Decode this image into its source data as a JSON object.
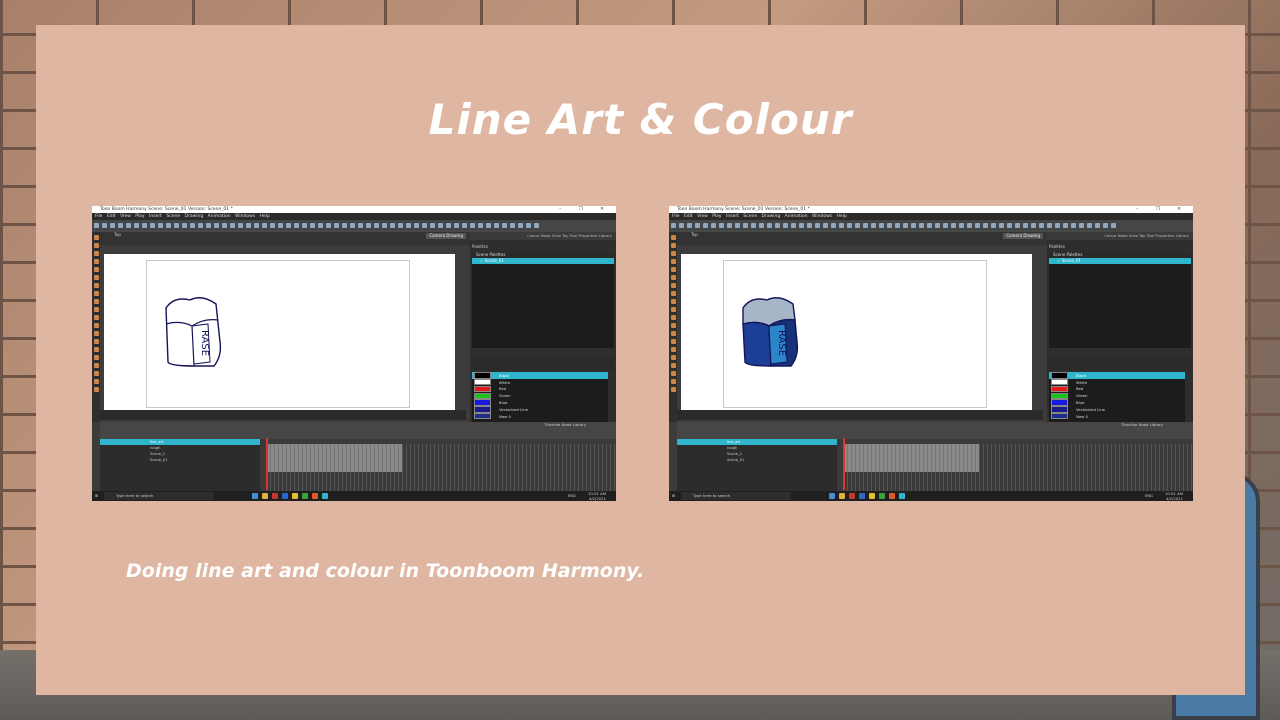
{
  "slide": {
    "title": "Line Art & Colour",
    "caption": "Doing line art and colour in Toonboom Harmony."
  },
  "app": {
    "window_title": "Toon Boom Harmony Scene: Scene_01 Version: Scene_01 *",
    "window_controls": "– ❐ ✕",
    "menu": "File  Edit  View  Play  Insert  Scene  Drawing  Animation  Windows  Help",
    "view_label": "Top",
    "view_tab": "Camera  Drawing",
    "panel_tabs": "Colour  Node View  Top  Tool Properties  Library",
    "palettes_label": "Palettes",
    "scene_palettes": "Scene Palettes",
    "selected_palette": "✓ Scene_01",
    "colors": [
      {
        "name": "Black",
        "hex": "#000000"
      },
      {
        "name": "White",
        "hex": "#ffffff"
      },
      {
        "name": "Red",
        "hex": "#e11a1a"
      },
      {
        "name": "Green",
        "hex": "#1ac21a"
      },
      {
        "name": "Blue",
        "hex": "#1a1ae1"
      },
      {
        "name": "Vectorized Line",
        "hex": "#1a1a8a"
      },
      {
        "name": "New 0",
        "hex": "#1e2e8a"
      },
      {
        "name": "New 0",
        "hex": "#1e2e8a"
      }
    ],
    "timeline_tab": "Timeline  Node Library",
    "layers": [
      "line_art",
      "rough",
      "Scene_1",
      "Scene_01"
    ],
    "eraser_text": "RASE",
    "taskbar_search": "Type here to search",
    "clock_time": "10:01 AM",
    "clock_date": "4/2/2021",
    "lang": "ENG"
  },
  "accent_color": "#2fb6cc",
  "fill_colors": {
    "body": "#1d3e96",
    "top": "#a6b6c6",
    "outline": "#14145a"
  }
}
